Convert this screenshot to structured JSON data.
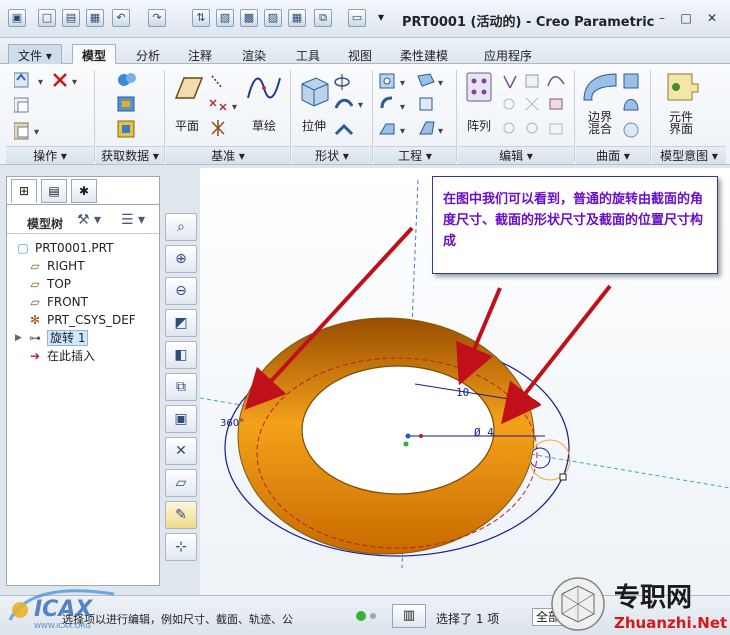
{
  "window": {
    "title": "PRT0001 (活动的) - Creo Parametric",
    "minimize": "–",
    "restore": "□",
    "close": "✕"
  },
  "tabs": [
    {
      "label": "文件"
    },
    {
      "label": "模型"
    },
    {
      "label": "分析"
    },
    {
      "label": "注释"
    },
    {
      "label": "渲染"
    },
    {
      "label": "工具"
    },
    {
      "label": "视图"
    },
    {
      "label": "柔性建模"
    },
    {
      "label": "应用程序"
    }
  ],
  "ribbon": {
    "groups": [
      "操作",
      "获取数据",
      "基准",
      "形状",
      "工程",
      "编辑",
      "曲面",
      "模型意图"
    ],
    "buttons": {
      "plane": "平面",
      "sketch": "草绘",
      "extrude": "拉伸",
      "pattern": "阵列",
      "boundary_blend": "边界\n混合",
      "component_interface": "元件\n界面"
    }
  },
  "model_tree": {
    "title": "模型树",
    "items": [
      {
        "label": "PRT0001.PRT",
        "icon": "part-icon"
      },
      {
        "label": "RIGHT",
        "icon": "datum-plane-icon"
      },
      {
        "label": "TOP",
        "icon": "datum-plane-icon"
      },
      {
        "label": "FRONT",
        "icon": "datum-plane-icon"
      },
      {
        "label": "PRT_CSYS_DEF",
        "icon": "csys-icon"
      },
      {
        "label": "旋转 1",
        "icon": "revolve-icon"
      },
      {
        "label": "在此插入",
        "icon": "insert-here-arrow-icon"
      }
    ]
  },
  "graphics": {
    "callout_text": "在图中我们可以看到，普通的旋转由截面的角度尺寸、截面的形状尺寸及截面的位置尺寸构成",
    "dimensions": {
      "angle": "360°",
      "position": "10",
      "diameter": "Ø 4"
    }
  },
  "status": {
    "message": "选择项以进行编辑，例如尺寸、截面、轨迹、公",
    "selected": "选择了 1 项",
    "filter": "全部"
  },
  "watermark": {
    "site_zh": "专职网",
    "site_url": "Zhuanzhi.Net",
    "logo": "ICAX",
    "logo_url": "WWW.ICAX.ORG"
  },
  "colors": {
    "torus": "#e58a0c",
    "callout_text": "#6a10c8",
    "arrow": "#c0101a",
    "dimension": "#1a1a8a"
  }
}
